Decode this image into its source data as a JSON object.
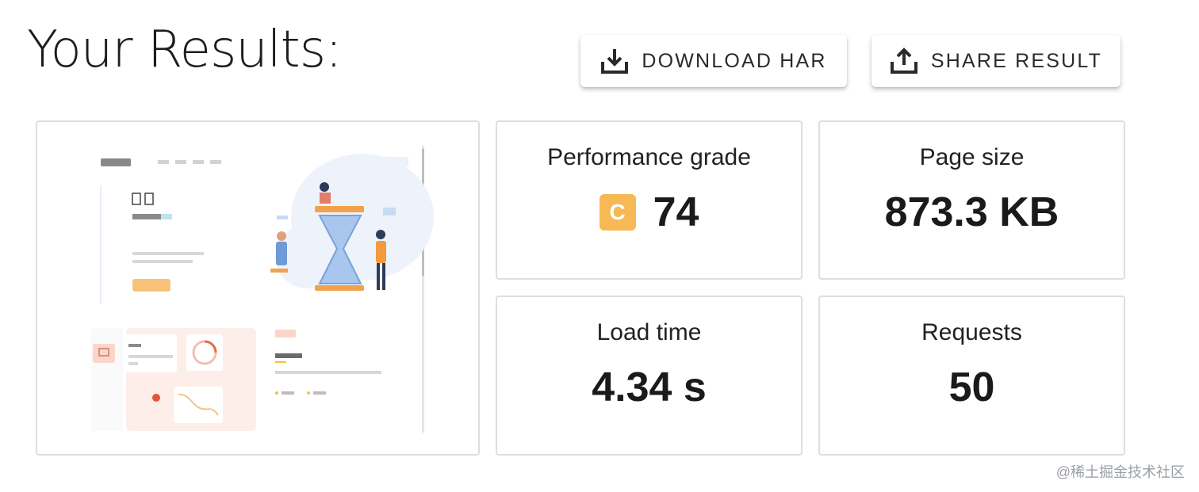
{
  "header": {
    "title": "Your Results:",
    "download_label": "DOWNLOAD HAR",
    "share_label": "SHARE RESULT",
    "download_icon": "download-icon",
    "share_icon": "upload-icon"
  },
  "metrics": {
    "performance": {
      "label": "Performance grade",
      "grade": "C",
      "score": "74",
      "grade_color": "#f7b955"
    },
    "page_size": {
      "label": "Page size",
      "value": "873.3 KB"
    },
    "load_time": {
      "label": "Load time",
      "value": "4.34 s"
    },
    "requests": {
      "label": "Requests",
      "value": "50"
    }
  },
  "watermark": "@稀土掘金技术社区"
}
